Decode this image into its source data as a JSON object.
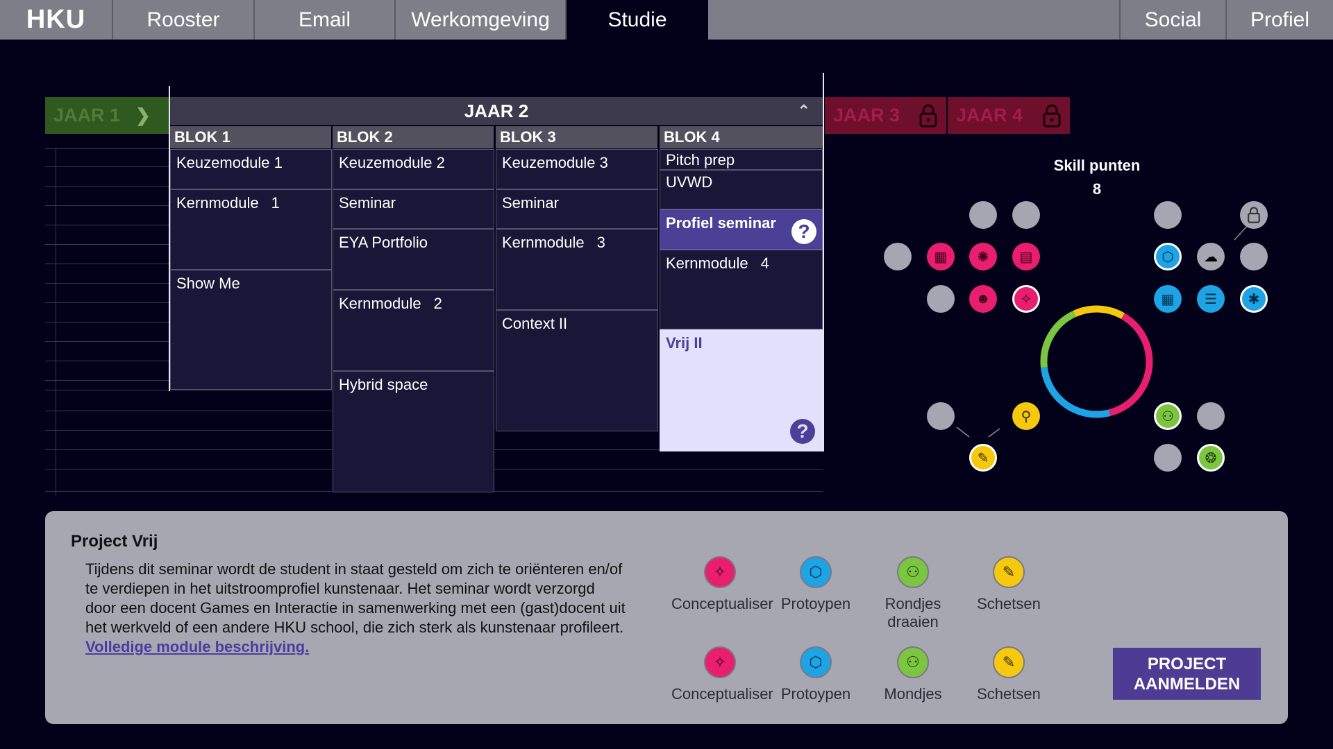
{
  "nav": {
    "logo": "HKU",
    "items": [
      "Rooster",
      "Email",
      "Werkomgeving",
      "Studie"
    ],
    "right_items": [
      "Social",
      "Profiel"
    ],
    "active": "Studie"
  },
  "years": {
    "jaar1": "JAAR 1",
    "jaar2": "JAAR 2",
    "jaar3": "JAAR 3",
    "jaar4": "JAAR 4"
  },
  "blocks": {
    "blok1": {
      "title": "BLOK 1",
      "cells": [
        {
          "label": "Keuzemodule 1"
        },
        {
          "label": "Kernmodule",
          "num": "1"
        },
        {
          "label": "Show Me"
        }
      ]
    },
    "blok2": {
      "title": "BLOK 2",
      "cells": [
        {
          "label": "Keuzemodule 2"
        },
        {
          "label": "Seminar"
        },
        {
          "label": "EYA Portfolio"
        },
        {
          "label": "Kernmodule",
          "num": "2"
        },
        {
          "label": "Hybrid space"
        }
      ]
    },
    "blok3": {
      "title": "BLOK 3",
      "cells": [
        {
          "label": "Keuzemodule 3"
        },
        {
          "label": "Seminar"
        },
        {
          "label": "Kernmodule",
          "num": "3"
        },
        {
          "label": "Context II"
        }
      ]
    },
    "blok4": {
      "title": "BLOK 4",
      "cells": [
        {
          "label": "Pitch prep"
        },
        {
          "label": "UVWD"
        },
        {
          "label": "Profiel seminar"
        },
        {
          "label": "Kernmodule",
          "num": "4"
        },
        {
          "label": "Vrij II"
        }
      ]
    }
  },
  "skills": {
    "title": "Skill punten",
    "value": "8",
    "colors": {
      "pink": "#ea1e6e",
      "blue": "#1ea3e4",
      "green": "#7cc540",
      "yellow": "#f6c90e",
      "grey": "#a6a6b2"
    }
  },
  "panel": {
    "title": "Project Vrij",
    "description": "Tijdens dit seminar wordt de student in staat gesteld om zich te oriënteren en/of te verdiepen in het uitstroomprofiel kunstenaar. Het seminar wordt verzorgd door een docent Games en Interactie in samenwerking met een (gast)docent uit het werkveld of een andere HKU school, die zich sterk als kunstenaar profileert.",
    "link": "Volledige module beschrijving.",
    "skills_row1": [
      "Conceptualiser",
      "Protoypen",
      "Rondjes draaien",
      "Schetsen"
    ],
    "skills_row2": [
      "Conceptualiser",
      "Protoypen",
      "Mondjes",
      "Schetsen"
    ],
    "enroll_button": "PROJECT AANMELDEN"
  },
  "icons": {
    "help": "?",
    "chevron_down": "﹀",
    "chevron_up": "︿",
    "lock": "🔒"
  }
}
